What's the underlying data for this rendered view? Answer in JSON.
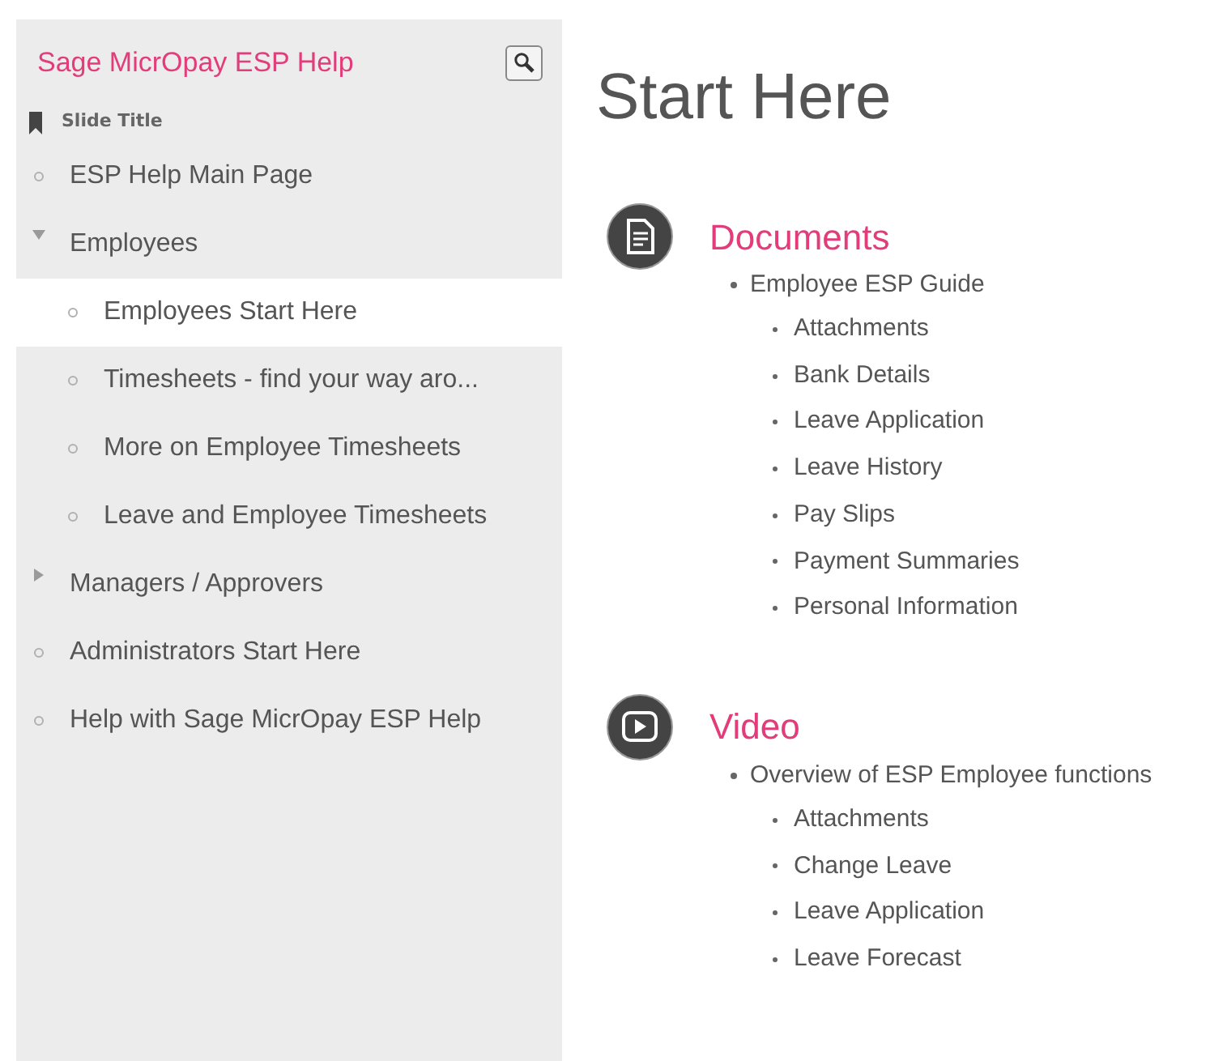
{
  "sidebar": {
    "title": "Sage MicrOpay ESP Help",
    "section_label": "Slide Title",
    "items": [
      {
        "kind": "page",
        "label": "ESP Help Main Page",
        "selected": false
      },
      {
        "kind": "folder",
        "label": "Employees",
        "selected": false,
        "expanded": true,
        "children": [
          {
            "kind": "page",
            "label": "Employees Start Here",
            "selected": true
          },
          {
            "kind": "page",
            "label": "Timesheets - find your way aro...",
            "selected": false
          },
          {
            "kind": "page",
            "label": "More on Employee Timesheets",
            "selected": false
          },
          {
            "kind": "page",
            "label": "Leave and Employee Timesheets",
            "selected": false
          }
        ]
      },
      {
        "kind": "folder",
        "label": "Managers / Approvers",
        "selected": false,
        "expanded": false
      },
      {
        "kind": "page",
        "label": "Administrators Start Here",
        "selected": false
      },
      {
        "kind": "page",
        "label": "Help with Sage MicrOpay ESP Help",
        "selected": false
      }
    ]
  },
  "page": {
    "title": "Start Here",
    "sections": [
      {
        "kind": "document",
        "heading": "Documents",
        "items": [
          {
            "label": "Employee ESP Guide",
            "children": [
              {
                "label": "Attachments"
              },
              {
                "label": "Bank Details"
              },
              {
                "label": "Leave Application"
              },
              {
                "label": "Leave History"
              },
              {
                "label": "Pay Slips"
              },
              {
                "label": "Payment Summaries"
              },
              {
                "label": "Personal Information"
              }
            ]
          }
        ]
      },
      {
        "kind": "video",
        "heading": "Video",
        "items": [
          {
            "label": "Overview of ESP Employee functions",
            "children": [
              {
                "label": "Attachments"
              },
              {
                "label": "Change Leave"
              },
              {
                "label": "Leave Application"
              },
              {
                "label": "Leave Forecast"
              }
            ]
          }
        ]
      }
    ]
  }
}
